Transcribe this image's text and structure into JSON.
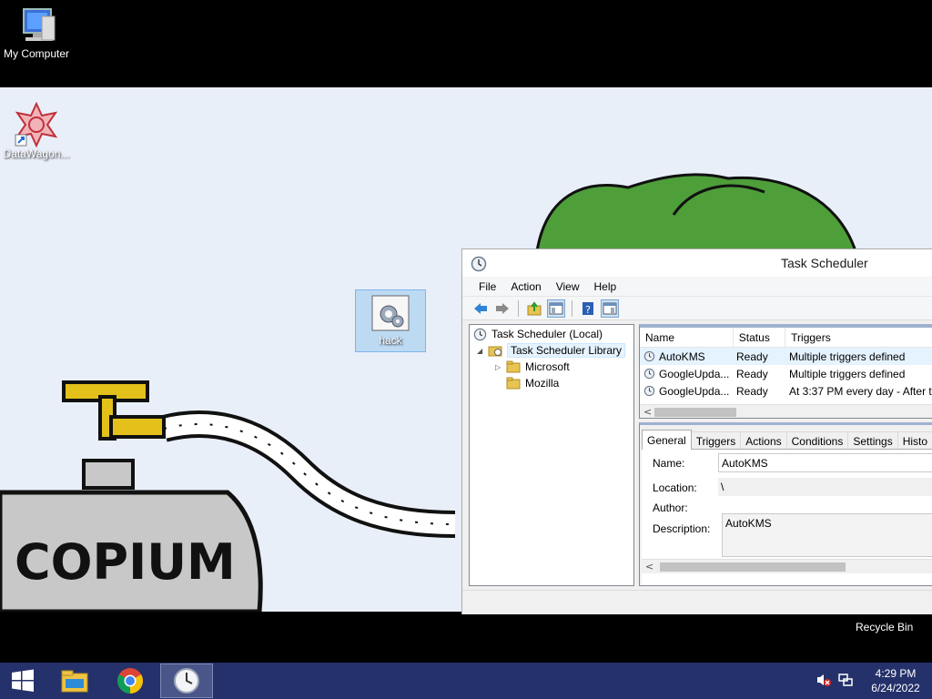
{
  "desktop": {
    "icons": {
      "my_computer": "My Computer",
      "datawagon": "DataWagon...",
      "hack": "hack",
      "recycle_bin": "Recycle Bin"
    },
    "wallpaper_text": "COPIUM"
  },
  "window": {
    "title": "Task Scheduler",
    "menu": [
      "File",
      "Action",
      "View",
      "Help"
    ],
    "toolbar_icons": [
      "back-arrow-icon",
      "forward-arrow-icon",
      "up-folder-icon",
      "show-hide-console-tree-icon",
      "help-icon",
      "show-hide-action-pane-icon"
    ]
  },
  "tree": {
    "root": "Task Scheduler (Local)",
    "library": "Task Scheduler Library",
    "children": [
      "Microsoft",
      "Mozilla"
    ]
  },
  "task_list": {
    "columns": [
      "Name",
      "Status",
      "Triggers"
    ],
    "rows": [
      {
        "name": "AutoKMS",
        "status": "Ready",
        "triggers": "Multiple triggers defined"
      },
      {
        "name": "GoogleUpda...",
        "status": "Ready",
        "triggers": "Multiple triggers defined"
      },
      {
        "name": "GoogleUpda...",
        "status": "Ready",
        "triggers": "At 3:37 PM every day - After t"
      }
    ]
  },
  "details": {
    "tabs": [
      "General",
      "Triggers",
      "Actions",
      "Conditions",
      "Settings",
      "Histo"
    ],
    "labels": {
      "name": "Name:",
      "location": "Location:",
      "author": "Author:",
      "description": "Description:"
    },
    "values": {
      "name": "AutoKMS",
      "location": "\\",
      "author": "",
      "description": "AutoKMS"
    }
  },
  "taskbar": {
    "apps": [
      "start-button",
      "file-explorer",
      "google-chrome",
      "task-scheduler"
    ],
    "time": "4:29 PM",
    "date": "6/24/2022"
  },
  "colors": {
    "taskbar": "#25316a",
    "wallpaper": "#e9eff9",
    "selection": "#e5f3ff"
  }
}
